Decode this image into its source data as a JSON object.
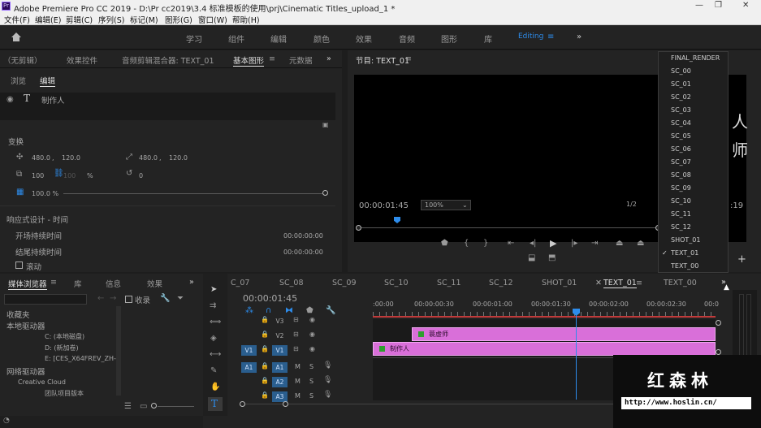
{
  "title": "Adobe Premiere Pro CC 2019 - D:\\Pr cc2019\\3.4 标准模板的使用\\prj\\Cinematic Titles_upload_1 *",
  "logo_text": "Pr",
  "window_controls": [
    "—",
    "❐",
    "✕"
  ],
  "menu": [
    "文件(F)",
    "编辑(E)",
    "剪辑(C)",
    "序列(S)",
    "标记(M)",
    "图形(G)",
    "窗口(W)",
    "帮助(H)"
  ],
  "workspaces": [
    "学习",
    "组件",
    "编辑",
    "颜色",
    "效果",
    "音频",
    "图形",
    "库"
  ],
  "workspace_active": "Editing",
  "overflow": "»",
  "top_panel": {
    "tabs": [
      "（无剪辑）",
      "效果控件",
      "音频剪辑混合器: TEXT_01",
      "基本图形",
      "元数据"
    ],
    "subtabs": [
      "浏览",
      "编辑"
    ],
    "layer_name": "制作人",
    "transform_label": "变换",
    "pos_x": "480.0",
    "pos_y": "120.0",
    "anchor_x": "480.0",
    "anchor_y": "120.0",
    "scale": "100",
    "scale2": "100",
    "pct": "%",
    "rotation": "0",
    "opacity": "100.0 %",
    "responsive_label": "响应式设计 - 时间",
    "intro_label": "开场持续时间",
    "intro_value": "00:00:00:00",
    "outro_label": "结尾持续时间",
    "outro_value": "00:00:00:00",
    "roll_label": "滚动"
  },
  "program": {
    "title": "节目: TEXT_01",
    "timecode": "00:00:01:45",
    "zoom": "100%",
    "quality": "1/2",
    "right_tc": ":19",
    "frame_glyphs": [
      "人",
      "师"
    ]
  },
  "dropdown": {
    "items": [
      "FINAL_RENDER",
      "SC_00",
      "SC_01",
      "SC_02",
      "SC_03",
      "SC_04",
      "SC_05",
      "SC_06",
      "SC_07",
      "SC_08",
      "SC_09",
      "SC_10",
      "SC_11",
      "SC_12",
      "SHOT_01",
      "TEXT_01",
      "TEXT_00"
    ],
    "checked": "TEXT_01"
  },
  "media_browser": {
    "tabs": [
      "媒体浏览器",
      "库",
      "信息",
      "效果"
    ],
    "ingest_label": "收录",
    "tree": [
      "收藏夹",
      "本地驱动器",
      "C: (本地磁盘)",
      "D: (新加卷)",
      "E: [CES_X64FREV_ZH-C",
      "网络驱动器",
      "Creative Cloud",
      "团队项目版本"
    ]
  },
  "timeline": {
    "tabs": [
      "C_07",
      "SC_08",
      "SC_09",
      "SC_10",
      "SC_11",
      "SC_12",
      "SHOT_01",
      "TEXT_01",
      "TEXT_00"
    ],
    "active_tab": "TEXT_01",
    "timecode": "00:00:01:45",
    "ruler": [
      ":00:00",
      "00:00:00:30",
      "00:00:01:00",
      "00:00:01:30",
      "00:00:02:00",
      "00:00:02:30",
      "00:0"
    ],
    "tracks": [
      "V3",
      "V2",
      "V1",
      "A1",
      "A2",
      "A3"
    ],
    "src_v": "V1",
    "src_a": "A1",
    "m": "M",
    "s": "S",
    "clips": [
      {
        "name": "蓑虚师"
      },
      {
        "name": "制作人"
      }
    ]
  },
  "watermark": {
    "title": "红森林",
    "url": "http://www.hoslin.cn/"
  },
  "colors": {
    "accent": "#2d8ceb",
    "clip": "#d96fd9",
    "playhead": "#2d8ceb"
  }
}
